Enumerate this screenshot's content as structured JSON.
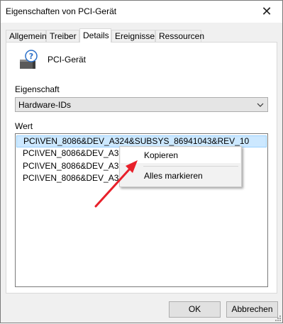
{
  "window": {
    "title": "Eigenschaften von PCI-Gerät",
    "close_symbol": "✕"
  },
  "tabs": [
    {
      "label": "Allgemein"
    },
    {
      "label": "Treiber"
    },
    {
      "label": "Details"
    },
    {
      "label": "Ereignisse"
    },
    {
      "label": "Ressourcen"
    }
  ],
  "active_tab": "Details",
  "device": {
    "name": "PCI-Gerät",
    "icon": "unknown-device-icon"
  },
  "property": {
    "label": "Eigenschaft",
    "selected": "Hardware-IDs"
  },
  "value": {
    "label": "Wert",
    "rows": [
      {
        "text": "PCI\\VEN_8086&DEV_A324&SUBSYS_86941043&REV_10"
      },
      {
        "text": "PCI\\VEN_8086&DEV_A324&"
      },
      {
        "text": "PCI\\VEN_8086&DEV_A324&"
      },
      {
        "text": "PCI\\VEN_8086&DEV_A324&"
      }
    ]
  },
  "context_menu": {
    "items": [
      {
        "label": "Kopieren"
      },
      {
        "label": "Alles markieren"
      }
    ]
  },
  "buttons": {
    "ok": "OK",
    "cancel": "Abbrechen"
  },
  "colors": {
    "selection": "#cce8ff",
    "arrow": "#e8202a"
  }
}
